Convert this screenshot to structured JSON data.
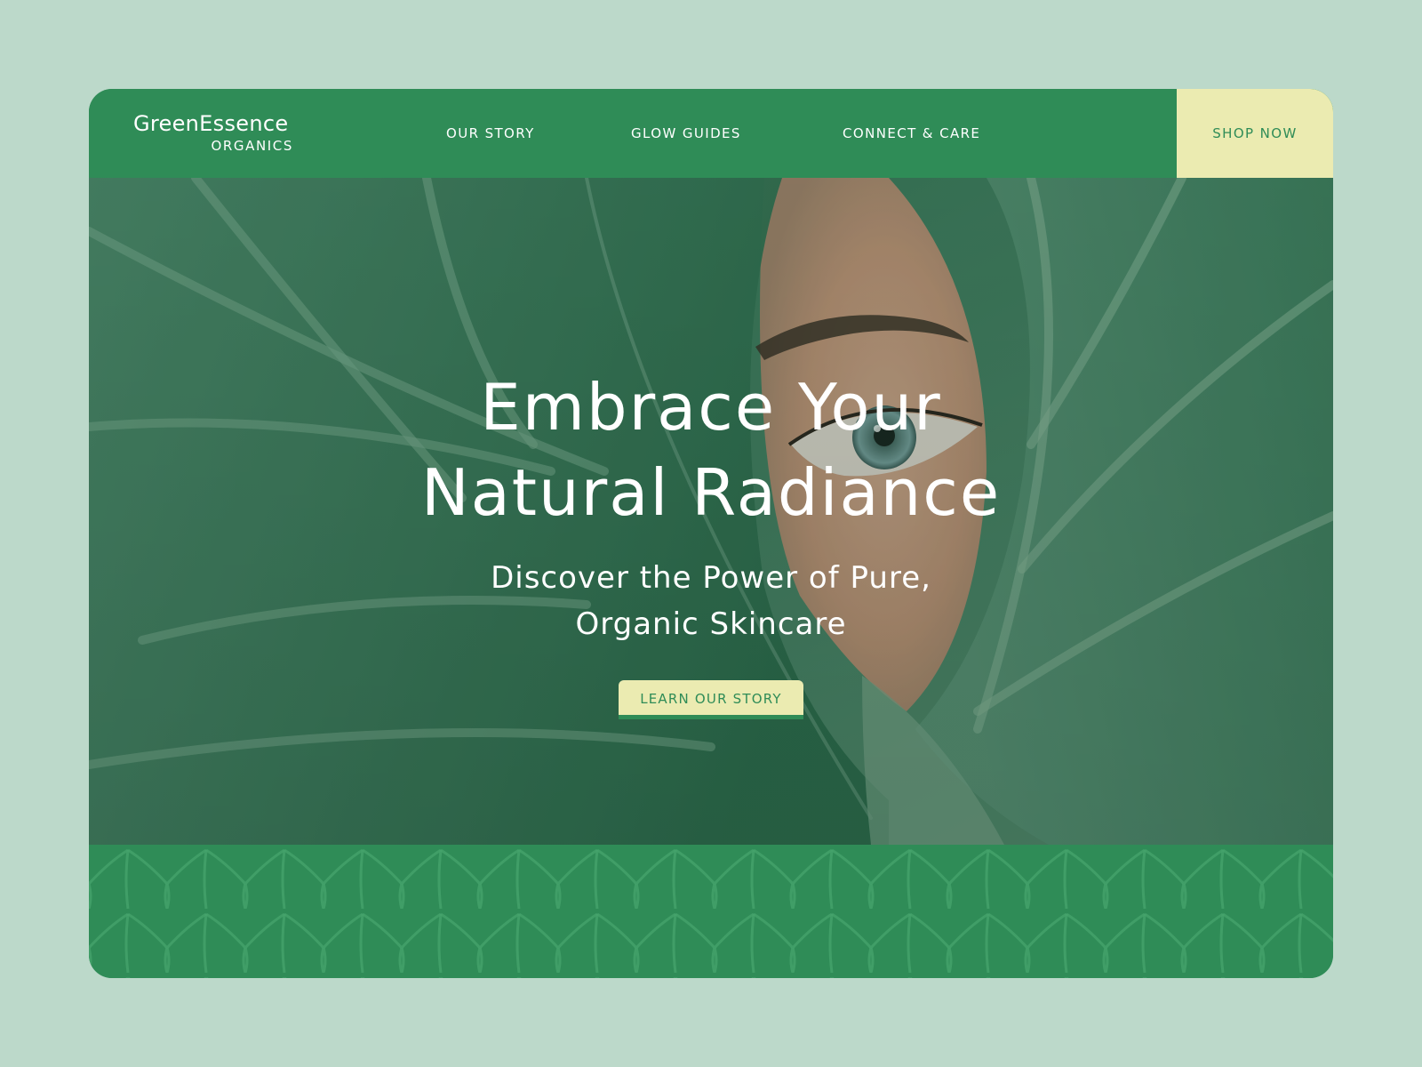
{
  "brand": {
    "name": "GreenEssence",
    "subtitle": "ORGANICS"
  },
  "nav": {
    "items": [
      {
        "label": "OUR STORY"
      },
      {
        "label": "GLOW GUIDES"
      },
      {
        "label": "CONNECT & CARE"
      }
    ],
    "shop_label": "SHOP NOW"
  },
  "hero": {
    "title_line1": "Embrace Your",
    "title_line2": "Natural Radiance",
    "subtitle_line1": "Discover the Power of Pure,",
    "subtitle_line2": "Organic Skincare",
    "cta_label": "LEARN OUR STORY",
    "image_alt": "leaf-and-eye-photo"
  },
  "colors": {
    "page_bg": "#bcd9ca",
    "brand_green": "#2f8c57",
    "accent_cream": "#ebebb1",
    "text_white": "#ffffff"
  },
  "icons": {
    "pattern": "leaf-chevron-pattern"
  }
}
